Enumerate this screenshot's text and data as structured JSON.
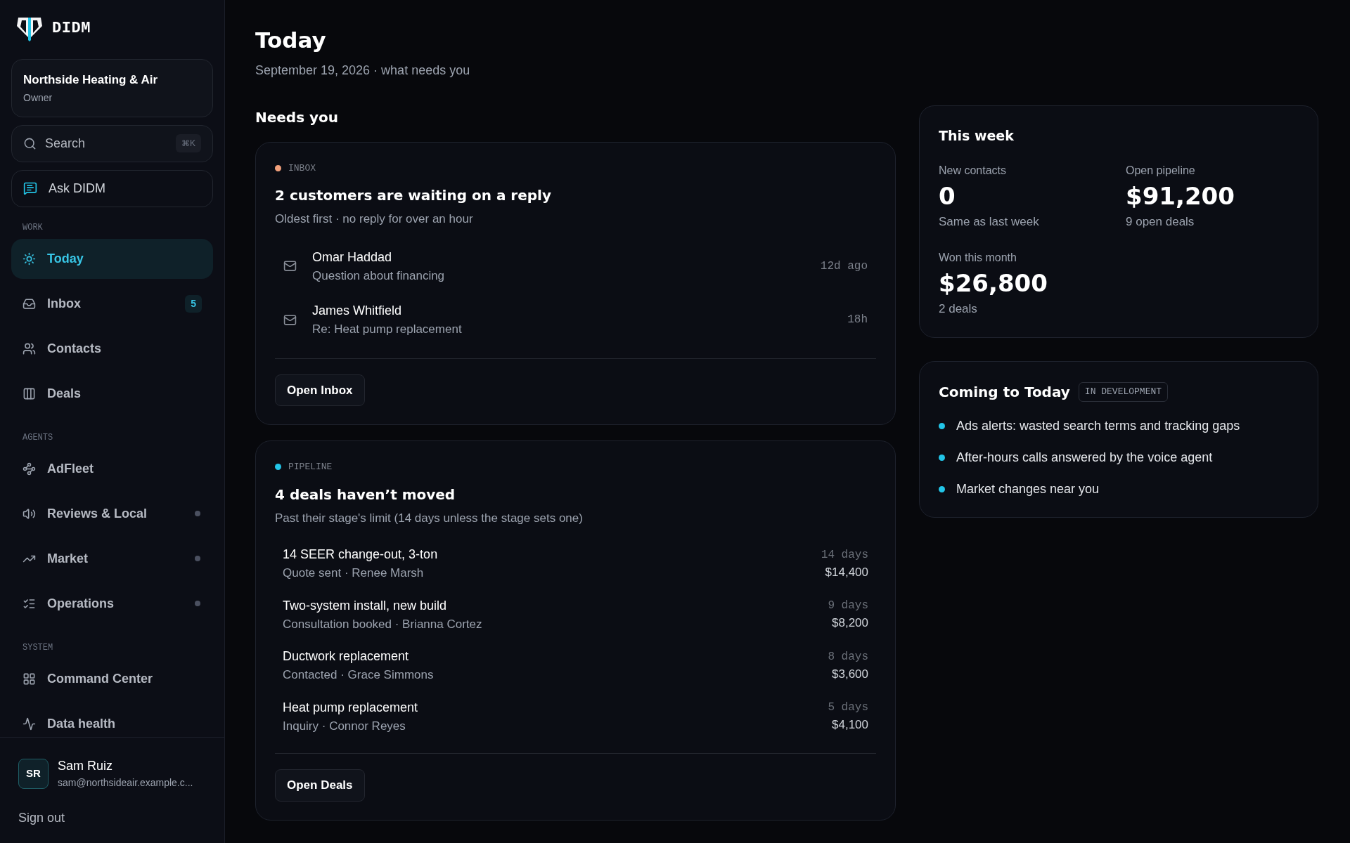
{
  "sidebar": {
    "brand": "DIDM",
    "org": {
      "name": "Northside Heating & Air",
      "role": "Owner"
    },
    "search": {
      "placeholder": "Search",
      "shortcut": "⌘K"
    },
    "ask_button": "Ask DIDM",
    "sections": [
      {
        "label": "WORK",
        "items": [
          {
            "label": "Today",
            "selected": true,
            "dot": false
          },
          {
            "label": "Inbox",
            "selected": false,
            "dot": false,
            "badge": "5"
          },
          {
            "label": "Contacts",
            "selected": false,
            "dot": false
          },
          {
            "label": "Deals",
            "selected": false,
            "dot": false
          }
        ]
      },
      {
        "label": "AGENTS",
        "items": [
          {
            "label": "AdFleet",
            "selected": false,
            "dot": false
          },
          {
            "label": "Reviews & Local",
            "selected": false,
            "dot": true
          },
          {
            "label": "Market",
            "selected": false,
            "dot": true
          },
          {
            "label": "Operations",
            "selected": false,
            "dot": true
          }
        ]
      },
      {
        "label": "SYSTEM",
        "items": [
          {
            "label": "Command Center",
            "selected": false,
            "dot": false
          },
          {
            "label": "Data health",
            "selected": false,
            "dot": false
          }
        ]
      }
    ],
    "user": {
      "initials": "SR",
      "name": "Sam Ruiz",
      "email": "sam@northsideair.example.c..."
    },
    "sign_out": "Sign out"
  },
  "page": {
    "title": "Today",
    "subtitle": "September 19, 2026 · what needs you"
  },
  "section_title": "Needs you",
  "cards": [
    {
      "kind": "inbox",
      "label": "INBOX",
      "color": "#f2a07b",
      "title": "2 customers are waiting on a reply",
      "subtitle": "Oldest first · no reply for over an hour",
      "button": "Open Inbox",
      "rows": [
        {
          "name": "Omar Haddad",
          "detail": "Question about financing",
          "age": "12d ago"
        },
        {
          "name": "James Whitfield",
          "detail": "Re: Heat pump replacement",
          "age": "18h"
        }
      ]
    },
    {
      "kind": "pipeline",
      "label": "PIPELINE",
      "color": "#22c5e8",
      "title": "4 deals haven’t moved",
      "subtitle": "Past their stage's limit (14 days unless the stage sets one)",
      "button": "Open Deals",
      "rows": [
        {
          "name": "14 SEER change-out, 3-ton",
          "detail": "Quote sent · Renee Marsh",
          "age": "14 days",
          "amount": "$14,400"
        },
        {
          "name": "Two-system install, new build",
          "detail": "Consultation booked · Brianna Cortez",
          "age": "9 days",
          "amount": "$8,200"
        },
        {
          "name": "Ductwork replacement",
          "detail": "Contacted · Grace Simmons",
          "age": "8 days",
          "amount": "$3,600"
        },
        {
          "name": "Heat pump replacement",
          "detail": "Inquiry · Connor Reyes",
          "age": "5 days",
          "amount": "$4,100"
        }
      ]
    }
  ],
  "this_week": {
    "title": "This week",
    "stats": [
      {
        "label": "New contacts",
        "value": "0",
        "note": "Same as last week"
      },
      {
        "label": "Open pipeline",
        "value": "$91,200",
        "note": "9 open deals"
      },
      {
        "label": "Won this month",
        "value": "$26,800",
        "note": "2 deals"
      }
    ]
  },
  "coming": {
    "title": "Coming to Today",
    "badge": "IN DEVELOPMENT",
    "items": [
      "Ads alerts: wasted search terms and tracking gaps",
      "After-hours calls answered by the voice agent",
      "Market changes near you"
    ]
  }
}
